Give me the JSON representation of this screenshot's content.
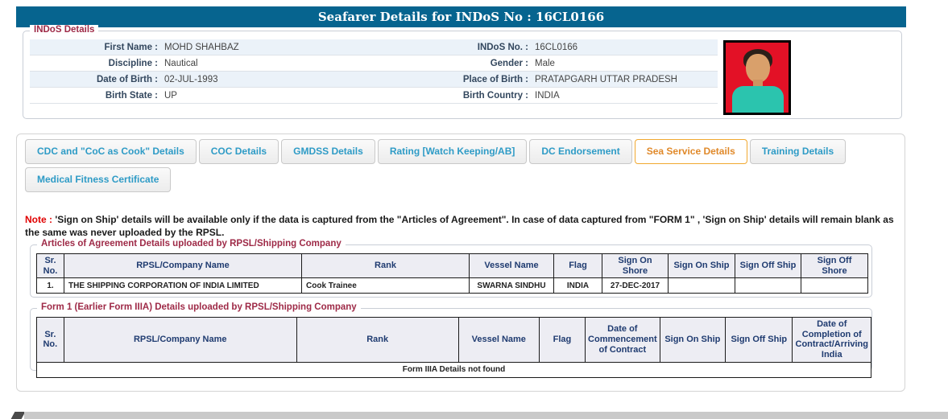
{
  "header": {
    "title": "Seafarer Details for INDoS No : 16CL0166"
  },
  "indos": {
    "legend": "INDoS Details",
    "rows": [
      {
        "l1": "First Name :",
        "v1": "MOHD SHAHBAZ",
        "l2": "INDoS No. :",
        "v2": "16CL0166"
      },
      {
        "l1": "Discipline :",
        "v1": "Nautical",
        "l2": "Gender :",
        "v2": "Male"
      },
      {
        "l1": "Date of Birth :",
        "v1": "02-JUL-1993",
        "l2": "Place of Birth :",
        "v2": "PRATAPGARH UTTAR PRADESH"
      },
      {
        "l1": "Birth State :",
        "v1": "UP",
        "l2": "Birth Country :",
        "v2": "INDIA"
      }
    ]
  },
  "tabs": {
    "items": [
      {
        "label": "CDC and \"CoC as Cook\" Details",
        "active": false
      },
      {
        "label": "COC Details",
        "active": false
      },
      {
        "label": "GMDSS Details",
        "active": false
      },
      {
        "label": "Rating [Watch Keeping/AB]",
        "active": false
      },
      {
        "label": "DC Endorsement",
        "active": false
      },
      {
        "label": "Sea Service Details",
        "active": true
      },
      {
        "label": "Training Details",
        "active": false
      },
      {
        "label": "Medical Fitness Certificate",
        "active": false
      }
    ]
  },
  "note": {
    "prefix": "Note :",
    "text": "'Sign on Ship' details will be available only if the data is captured from the \"Articles of Agreement\". In case of data captured from \"FORM 1\" , 'Sign on Ship' details will remain blank as the same was never uploaded by the RPSL."
  },
  "agreement_table": {
    "legend": "Articles of Agreement Details uploaded by RPSL/Shipping Company",
    "columns": [
      "Sr. No.",
      "RPSL/Company Name",
      "Rank",
      "Vessel Name",
      "Flag",
      "Sign On Shore",
      "Sign On Ship",
      "Sign Off Ship",
      "Sign Off Shore"
    ],
    "rows": [
      [
        "1.",
        "THE SHIPPING CORPORATION OF INDIA LIMITED",
        "Cook Trainee",
        "SWARNA SINDHU",
        "INDIA",
        "27-DEC-2017",
        "",
        "",
        ""
      ]
    ]
  },
  "form1_table": {
    "legend": "Form 1 (Earlier Form IIIA) Details uploaded by RPSL/Shipping Company",
    "columns": [
      "Sr. No.",
      "RPSL/Company Name",
      "Rank",
      "Vessel Name",
      "Flag",
      "Date of Commencement of Contract",
      "Sign On Ship",
      "Sign Off Ship",
      "Date of Completion of Contract/Arriving India"
    ],
    "empty_message": "Form IIIA Details not found"
  },
  "colors": {
    "title_bar_bg": "#06648F",
    "section_label": "#9E2A47",
    "tab_text": "#2E9BC6",
    "tab_active_text": "#E0892A",
    "tab_active_border": "#F0A830",
    "table_header_text": "#1F3B70",
    "note_prefix": "#E00000",
    "empty_message": "#CC0000",
    "row_stripe": "#EBF2F9",
    "photo_bg": "#E31126"
  }
}
